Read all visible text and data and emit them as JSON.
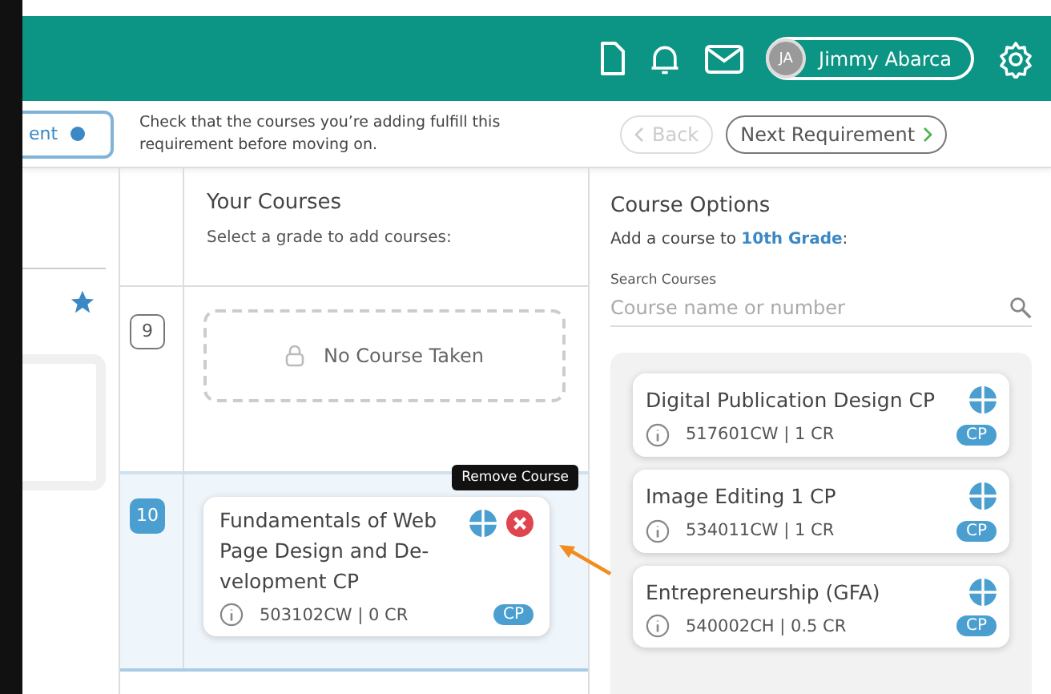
{
  "header": {
    "user": {
      "initials": "JA",
      "name": "Jimmy Abarca"
    }
  },
  "subheader": {
    "tab": {
      "label": "ent",
      "selected": true
    },
    "message": "Check that the courses you’re adding fulfill this requirement before moving on.",
    "back": {
      "label": "Back",
      "disabled": true
    },
    "next": {
      "label": "Next Requirement",
      "disabled": false
    }
  },
  "your_courses": {
    "title": "Your Courses",
    "subtitle": "Select a grade to add courses:",
    "grades": [
      {
        "grade": "9",
        "selected": false,
        "empty_label": "No Course Taken"
      },
      {
        "grade": "10",
        "selected": true,
        "courses": [
          {
            "name": "Fundamentals of Web Page Design and De-velopment CP",
            "code": "503102CW | 0 CR",
            "tag": "CP",
            "tooltip": "Remove Course"
          }
        ]
      }
    ]
  },
  "course_options": {
    "title": "Course Options",
    "prompt": "Add a course to **10th Grade**:",
    "search": {
      "label": "Search Courses",
      "placeholder": "Course name or number"
    },
    "courses": [
      {
        "name": "Digital Publication Design CP",
        "code": "517601CW | 1 CR",
        "tag": "CP"
      },
      {
        "name": "Image Editing 1 CP",
        "code": "534011CW | 1 CR",
        "tag": "CP"
      },
      {
        "name": "Entrepreneurship (GFA)",
        "code": "540002CH | 0.5 CR",
        "tag": "CP"
      }
    ]
  }
}
